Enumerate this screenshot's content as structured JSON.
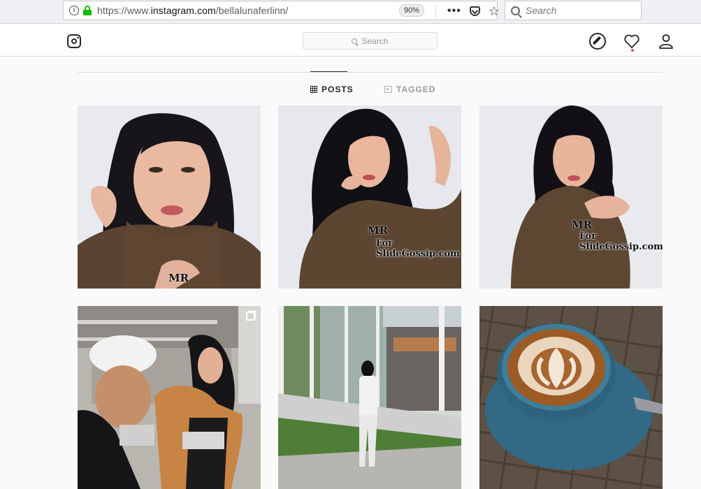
{
  "browser": {
    "url_prefix": "https://www.",
    "url_host": "instagram.com",
    "url_path": "/bellalunaferlinn/",
    "zoom": "90%",
    "search_placeholder": "Search"
  },
  "header": {
    "search_placeholder": "Search"
  },
  "tabs": [
    {
      "label": "POSTS",
      "active": true
    },
    {
      "label": "TAGGED",
      "active": false
    }
  ],
  "posts": [
    {
      "watermark": "",
      "mr_mark": "MR"
    },
    {
      "watermark": "For SlideGossip.com",
      "mr_mark": "MR"
    },
    {
      "watermark": "For SlideGossip.com",
      "mr_mark": "MR"
    },
    {
      "watermark": "",
      "mr_mark": ""
    },
    {
      "watermark": "",
      "mr_mark": ""
    },
    {
      "watermark": "",
      "mr_mark": ""
    }
  ],
  "colors": {
    "accent_green": "#12bc00",
    "notification_red": "#ed4956",
    "text_dark": "#262626"
  }
}
